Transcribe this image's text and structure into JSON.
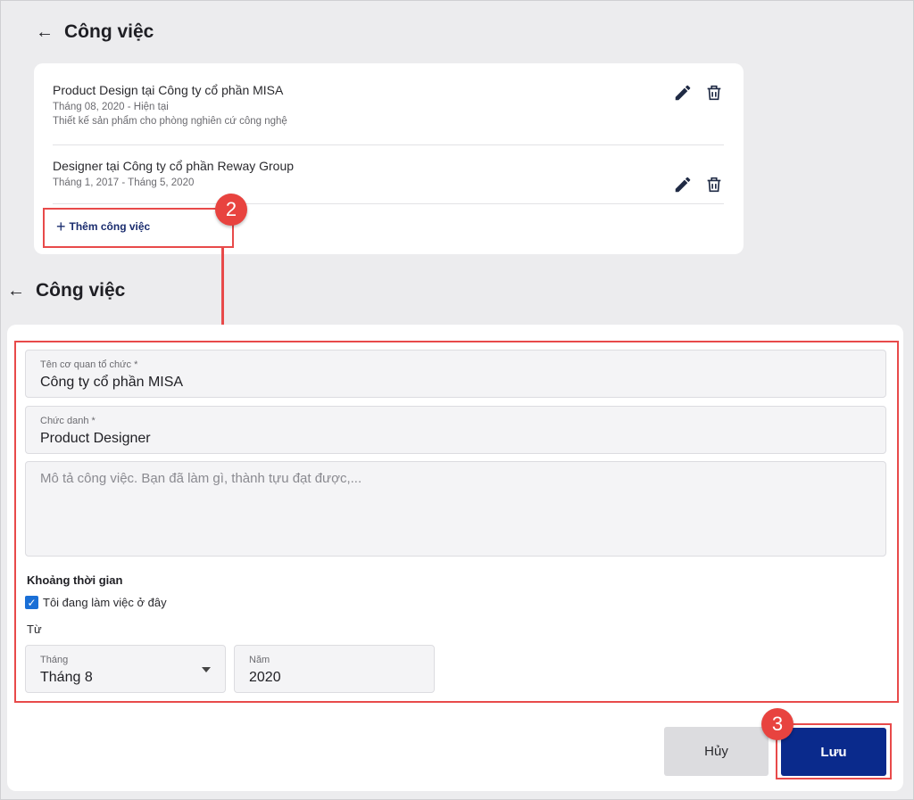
{
  "top_section": {
    "title": "Công việc",
    "jobs": [
      {
        "title": "Product Design tại Công ty cổ phần MISA",
        "period": "Tháng 08, 2020 - Hiện tại",
        "description": "Thiết kế sản phẩm cho phòng nghiên cứ công nghệ"
      },
      {
        "title": "Designer tại Công ty cổ phần Reway Group",
        "period": "Tháng 1, 2017 - Tháng 5, 2020"
      }
    ],
    "add_label": "Thêm công việc"
  },
  "annotations": {
    "step2": "2",
    "step3": "3",
    "highlight_color": "#e84a4a"
  },
  "form": {
    "title": "Công việc",
    "org_field": {
      "label": "Tên cơ quan tổ chức *",
      "value": "Công ty cổ phần MISA"
    },
    "position_field": {
      "label": "Chức danh *",
      "value": "Product Designer"
    },
    "description_field": {
      "placeholder": "Mô tả công việc. Bạn đã làm gì, thành tựu đạt được,..."
    },
    "period_label": "Khoảng thời gian",
    "current_checkbox": {
      "label": "Tôi đang làm việc ở đây",
      "checked": true
    },
    "from_label": "Từ",
    "month_field": {
      "label": "Tháng",
      "value": "Tháng 8"
    },
    "year_field": {
      "label": "Năm",
      "value": "2020"
    },
    "cancel_label": "Hủy",
    "save_label": "Lưu",
    "save_color": "#0a2a8c"
  }
}
